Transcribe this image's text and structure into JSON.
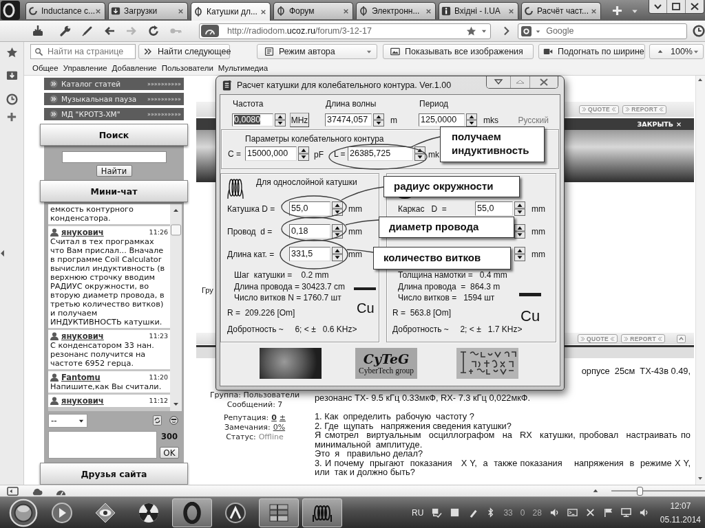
{
  "browser": {
    "tabs": [
      {
        "label": "Inductance c...",
        "kind": "loading",
        "selected": false
      },
      {
        "label": "Загрузки",
        "kind": "downloads",
        "selected": false
      },
      {
        "label": "Катушки дл...",
        "kind": "site",
        "selected": true
      },
      {
        "label": "Форум",
        "kind": "site",
        "selected": false
      },
      {
        "label": "Электронн...",
        "kind": "site",
        "selected": false
      },
      {
        "label": "Вхідні - I.UA",
        "kind": "info",
        "selected": false
      },
      {
        "label": "Расчёт част...",
        "kind": "loading",
        "selected": false
      }
    ],
    "back": {
      "disabled": false
    },
    "forward": {
      "disabled": true
    },
    "key": {
      "disabled": true
    },
    "address": "http://radiodom.**ucoz.ru**/forum/3-12-17",
    "search_field": {
      "placeholder": "Google"
    },
    "find_field": {
      "placeholder": "Найти на странице"
    },
    "find_next": "Найти следующее",
    "author_mode": "Режим автора",
    "show_images": "Показывать все изображения",
    "fit_width": "Подогнать по ширине",
    "zoom": "100%",
    "menu": [
      "Общее",
      "Управление",
      "Добавление",
      "Пользователи",
      "Мультимедиа"
    ]
  },
  "sidebar": {
    "links": [
      {
        "label": "Каталог статей",
        "arrows": "»»»»»»»»»»"
      },
      {
        "label": "Музыкальная пауза",
        "arrows": "»»»»»»»»»»"
      },
      {
        "label": "МД \"КРОТЗ-ХМ\"",
        "arrows": "»»»»»»»»»»"
      }
    ],
    "search": {
      "title": "Поиск",
      "button": "Найти"
    },
    "chat": {
      "title": "Мини-чат",
      "messages": [
        {
          "text": "емкость контурного конденсатора."
        },
        {
          "author": "янукович",
          "time": "11:26",
          "text": "Считал в тех програмках что Вам прислал... Вначале в программе Coil Calculator вычислил индуктивность (в верхнюю строчку вводим РАДИУС окружности, во вторую диаметр провода, в третью количество витков) и получаем ИНДУКТИВНОСТЬ катушки."
        },
        {
          "author": "янукович",
          "time": "11:23",
          "text": "С конденсатором 33 нан. резонанс получится на частоте 6952 герца."
        },
        {
          "author": "Fantomu",
          "time": "11:20",
          "text": "Напишите,как Вы считали."
        },
        {
          "author": "янукович",
          "time": "11:12"
        }
      ],
      "smiley_select": "--",
      "chars_left": "300",
      "send": "OK"
    },
    "friends_title": "Друзья сайта"
  },
  "page": {
    "post_bars": [
      {
        "buttons": [
          "QUOTE",
          "REPORT"
        ],
        "up_button": false
      },
      {
        "buttons": [
          "QUOTE",
          "REPORT"
        ],
        "up_button": true
      }
    ],
    "banner": {
      "close": "ЗАКРЫТЬ"
    },
    "previous_post": {
      "group": "Гру"
    },
    "post": {
      "group": "Группа: Пользователи",
      "messages": "Сообщений: 7",
      "reputation": {
        "label": "Репутация:",
        "value": "0",
        "action": "±"
      },
      "warnings": {
        "label": "Замечания:",
        "value": "0%"
      },
      "status": {
        "label": "Статус:",
        "value": "Offline"
      },
      "paragraphs": [
        "орпусе  25см  TX-43в 0.49,",
        "резонанс TX- 9.5 кГц 0.33мкФ, RX- 7.3 кГц 0,022мкФ.",
        "1. Как  определить  рабочую  частоту ?",
        "2. Где  щупать   напряжения сведения катушки?",
        "Я смотрел  виртуальным  осциллографом  на  RX  катушки, пробовал  настраивать по минимальной  амплитуде.",
        "Это  я   правильно делал?",
        "3. И почему  прыгают  показания   X Y,  а  также показания    напряжения  в  режиме X Y, или  так и должно быть?"
      ]
    }
  },
  "dialog": {
    "title": "Расчет катушки для колебательного контура. Ver.1.00",
    "top": [
      {
        "label": "Частота",
        "value": "0,0080",
        "highlighted": true,
        "unit": "MHz",
        "unit_button": true
      },
      {
        "label": "Длина волны",
        "value": "37474,057",
        "highlighted": false,
        "unit": "m",
        "unit_button": false
      },
      {
        "label": "Период",
        "value": "125,0000",
        "highlighted": false,
        "unit": "mks",
        "unit_button": false
      }
    ],
    "language": "Русский",
    "circuit": {
      "title": "Параметры колебательного контура",
      "fields": [
        {
          "label": "C =",
          "value": "15000,000",
          "unit": "pF"
        },
        {
          "label": "L =",
          "value": "26385,725",
          "unit": "mk"
        }
      ]
    },
    "single": {
      "title": "Для однослойной катушки",
      "fields": [
        {
          "label": "Катушка D =",
          "value": "55,0",
          "unit": "mm"
        },
        {
          "label": "Провод  d =",
          "value": "0,18",
          "unit": "mm"
        },
        {
          "label": "Длина кат. =",
          "value": "331,5",
          "unit": "mm"
        }
      ],
      "results": [
        "Шаг  катушки =    0.2 mm",
        "Длина провода = 30423.7 cm",
        "Число витков N = 1760.7 шт"
      ],
      "resistance": "R =  209.226 [Om]",
      "quality": "Добротность ~     6; < ±   0.6 KHz>",
      "metal": "Cu"
    },
    "multi": {
      "fields": [
        {
          "label": "Каркас   D  =",
          "value": "55,0",
          "unit": "mm"
        },
        {
          "unit": "mm"
        },
        {
          "unit": "mm"
        }
      ],
      "results": [
        "Толщина намотки =   0.4 mm",
        "Длина провода  =  864.3 m",
        "Число витков =   1594 шт"
      ],
      "resistance": "R =  563.8 [Om]",
      "quality": "Добротность ~     2; < ±   1.7 KHz>",
      "metal": "Cu"
    },
    "logo": {
      "title": "CyTeG",
      "subtitle": "CyberTech group"
    },
    "callouts": [
      {
        "text": "получаем индуктивность"
      },
      {
        "text": "радиус окружности"
      },
      {
        "text": "диаметр провода"
      },
      {
        "text": "количество витков"
      }
    ]
  },
  "statusbar": {
    "zoom_slider": {
      "level": 0.3
    }
  },
  "taskbar": {
    "apps": [
      {
        "kind": "player",
        "active": false
      },
      {
        "kind": "viewer",
        "active": false
      },
      {
        "kind": "radiation",
        "active": false
      },
      {
        "kind": "browser",
        "active": true
      },
      {
        "kind": "navigator",
        "active": false
      },
      {
        "kind": "archiver",
        "active": true
      },
      {
        "kind": "coil",
        "active": true
      }
    ],
    "language": "RU",
    "readings": [
      "33",
      "0",
      "28"
    ],
    "time": "12:07",
    "date": "05.11.2014"
  }
}
